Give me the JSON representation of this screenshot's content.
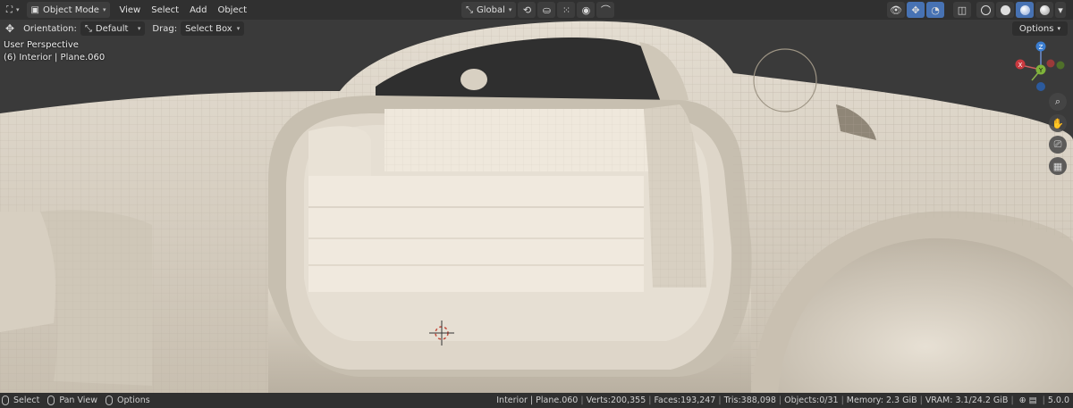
{
  "header": {
    "editor_type_icon": "3d-viewport-icon",
    "mode": "Object Mode",
    "menus": [
      "View",
      "Select",
      "Add",
      "Object"
    ],
    "transform_orientation": "Global",
    "right_icons": [
      "visibility-icon",
      "gizmo-icon",
      "overlay-icon",
      "xray-icon",
      "wireframe-shading",
      "solid-shading",
      "material-shading",
      "rendered-shading"
    ]
  },
  "toolbar": {
    "orientation_label": "Orientation:",
    "orientation_value": "Default",
    "drag_label": "Drag:",
    "drag_value": "Select Box",
    "options": "Options"
  },
  "viewport": {
    "perspective": "User Perspective",
    "object_info": "(6) Interior | Plane.060",
    "background": "#3a3a3a",
    "model_color": "#d9d1c3"
  },
  "gizmo": {
    "z": "Z",
    "y": "Y",
    "x": "X"
  },
  "status_bar": {
    "left": [
      {
        "key": "select",
        "label": "Select"
      },
      {
        "key": "pan",
        "label": "Pan View"
      },
      {
        "key": "options",
        "label": "Options"
      }
    ],
    "stats": [
      "Interior | Plane.060",
      "Verts:200,355",
      "Faces:193,247",
      "Tris:388,098",
      "Objects:0/31",
      "Memory: 2.3 GiB",
      "VRAM: 3.1/24.2 GiB"
    ],
    "version": "5.0.0"
  }
}
